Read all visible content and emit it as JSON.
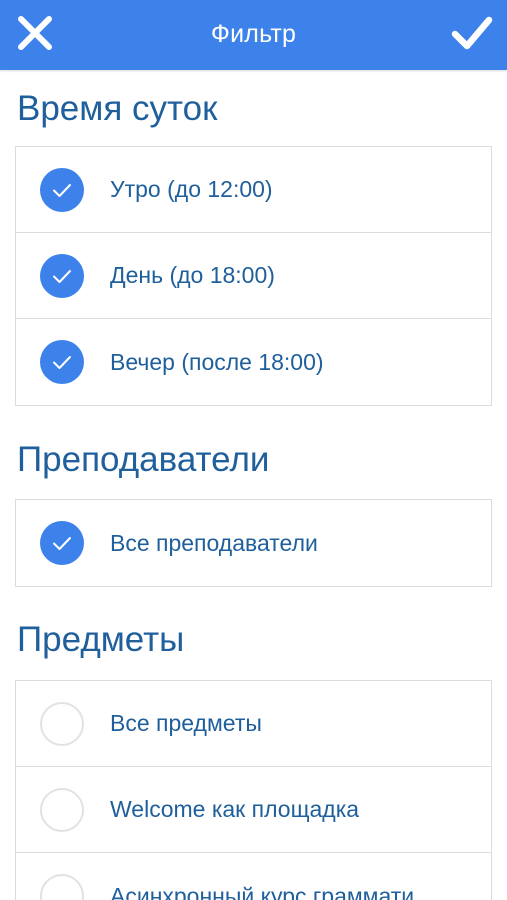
{
  "header": {
    "title": "Фильтр",
    "close_icon": "close-icon",
    "confirm_icon": "checkmark-icon",
    "bg_color": "#3c82ea"
  },
  "sections": [
    {
      "title": "Время суток",
      "items": [
        {
          "label": "Утро (до 12:00)",
          "checked": true
        },
        {
          "label": "День (до 18:00)",
          "checked": true
        },
        {
          "label": "Вечер (после 18:00)",
          "checked": true
        }
      ]
    },
    {
      "title": "Преподаватели",
      "items": [
        {
          "label": "Все преподаватели",
          "checked": true
        }
      ]
    },
    {
      "title": "Предметы",
      "items": [
        {
          "label": "Все предметы",
          "checked": false
        },
        {
          "label": "Welcome как площадка",
          "checked": false
        },
        {
          "label": "Асинхронный курс граммати",
          "checked": false
        }
      ]
    }
  ],
  "colors": {
    "accent": "#3c82ea",
    "text": "#1f5f9c",
    "border": "#dcdcdc"
  }
}
